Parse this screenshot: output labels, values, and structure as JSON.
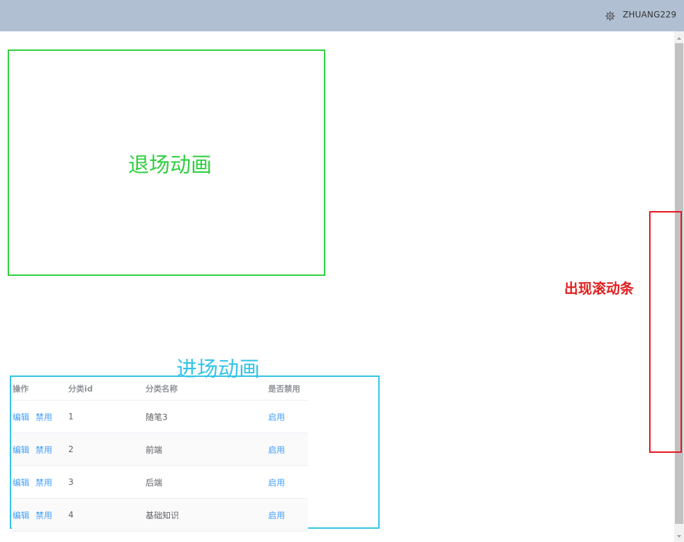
{
  "header": {
    "settings_icon": "gear-icon",
    "username": "ZHUANG229"
  },
  "annotations": {
    "exit_animation": "退场动画",
    "enter_animation": "进场动画",
    "scrollbar_appears": "出现滚动条"
  },
  "table": {
    "columns": [
      "操作",
      "分类id",
      "分类名称",
      "是否禁用"
    ],
    "rows": [
      {
        "edit": "编辑",
        "disable": "禁用",
        "id": "1",
        "name": "随笔3",
        "status": "启用"
      },
      {
        "edit": "编辑",
        "disable": "禁用",
        "id": "2",
        "name": "前端",
        "status": "启用"
      },
      {
        "edit": "编辑",
        "disable": "禁用",
        "id": "3",
        "name": "后端",
        "status": "启用"
      },
      {
        "edit": "编辑",
        "disable": "禁用",
        "id": "4",
        "name": "基础知识",
        "status": "启用"
      }
    ]
  },
  "colors": {
    "header_bg": "#b0c0d2",
    "exit_box": "#2fcf3f",
    "enter_box": "#33c4e8",
    "scroll_note": "#e8141e",
    "link": "#409eff"
  }
}
